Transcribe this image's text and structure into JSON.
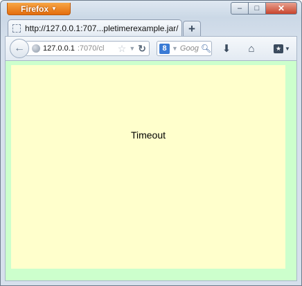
{
  "browser": {
    "app_button_label": "Firefox",
    "window_controls": {
      "minimize": "–",
      "maximize": "□",
      "close": "✕"
    }
  },
  "tab": {
    "title": "http://127.0.0.1:707...pletimerexample.jar/",
    "new_tab_label": "+"
  },
  "nav": {
    "url_host": "127.0.0.1",
    "url_rest": ":7070/cl",
    "search_placeholder": "Goog",
    "icons": [
      "back-icon",
      "globe-icon",
      "star-icon",
      "reload-icon",
      "google-icon",
      "search-icon",
      "downloads-icon",
      "home-icon",
      "bookmarks-icon"
    ]
  },
  "page": {
    "message": "Timeout",
    "colors": {
      "outer": "#ccffcc",
      "inner": "#ffffcc"
    }
  }
}
